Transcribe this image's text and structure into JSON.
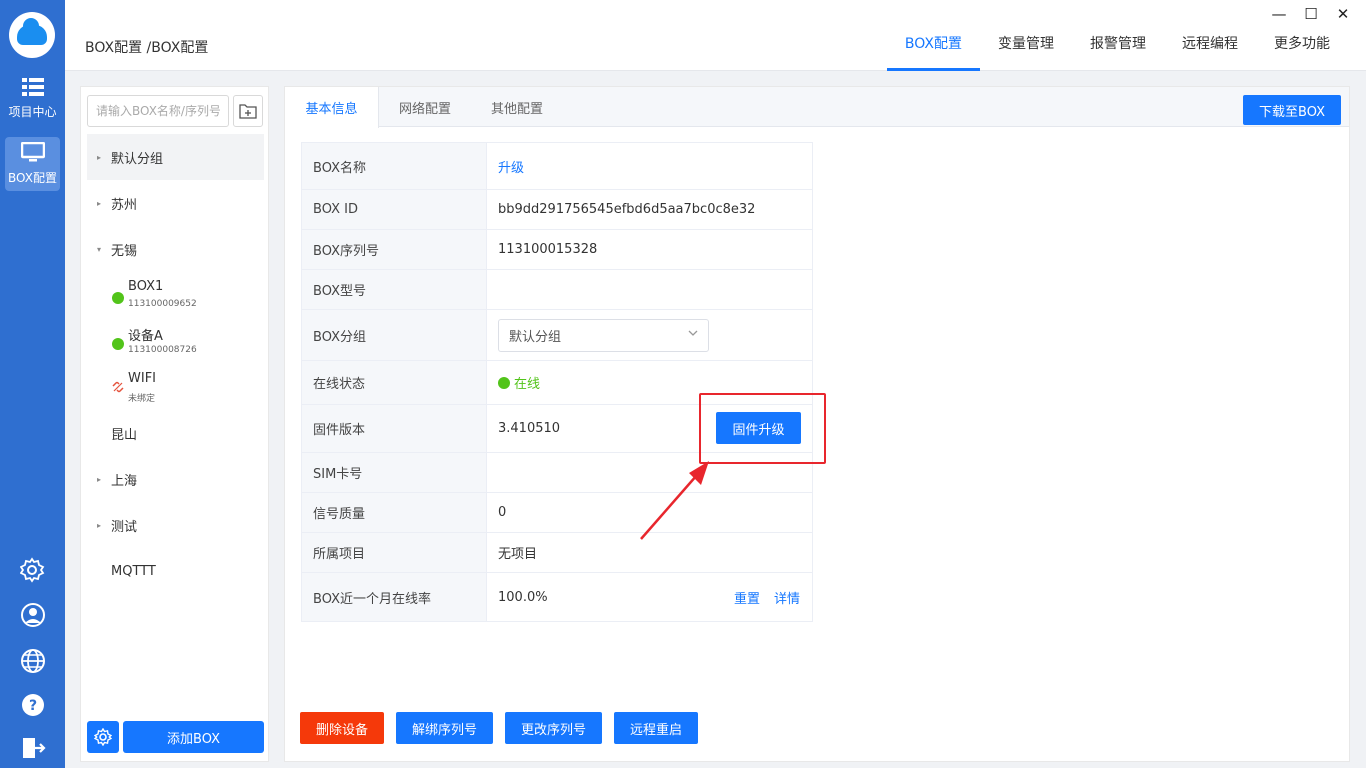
{
  "rail": {
    "items": [
      {
        "label": "项目中心",
        "icon": "grid-list-icon"
      },
      {
        "label": "BOX配置",
        "icon": "monitor-icon"
      }
    ],
    "bottom_icons": [
      "gear-wifi-icon",
      "user-icon",
      "globe-icon",
      "help-icon",
      "logout-icon"
    ]
  },
  "header": {
    "breadcrumb": "BOX配置 /BOX配置",
    "nav": [
      "BOX配置",
      "变量管理",
      "报警管理",
      "远程编程",
      "更多功能"
    ],
    "active_nav": "BOX配置"
  },
  "tree": {
    "search_placeholder": "请输入BOX名称/序列号",
    "groups": [
      {
        "label": "默认分组",
        "arrow": "▸"
      },
      {
        "label": "苏州",
        "arrow": "▸"
      },
      {
        "label": "无锡",
        "arrow": "▾"
      }
    ],
    "devices": [
      {
        "name": "BOX1",
        "sn": "113100009652",
        "status": "online"
      },
      {
        "name": "设备A",
        "sn": "113100008726",
        "status": "online"
      },
      {
        "name": "WIFI",
        "sn": "未绑定",
        "status": "unbound"
      }
    ],
    "groups_after": [
      {
        "label": "昆山",
        "arrow": ""
      },
      {
        "label": "上海",
        "arrow": "▸"
      },
      {
        "label": "测试",
        "arrow": "▸"
      },
      {
        "label": "MQTTT",
        "arrow": ""
      }
    ],
    "add_box": "添加BOX"
  },
  "tabs": [
    "基本信息",
    "网络配置",
    "其他配置"
  ],
  "download_button": "下载至BOX",
  "info": {
    "name_label": "BOX名称",
    "name_value": "升级",
    "id_label": "BOX ID",
    "id_value": "bb9dd291756545efbd6d5aa7bc0c8e32",
    "sn_label": "BOX序列号",
    "sn_value": "113100015328",
    "model_label": "BOX型号",
    "model_value": "",
    "group_label": "BOX分组",
    "group_value": "默认分组",
    "status_label": "在线状态",
    "status_value": "在线",
    "fw_label": "固件版本",
    "fw_value": "3.410510",
    "sim_label": "SIM卡号",
    "sim_value": "",
    "signal_label": "信号质量",
    "signal_value": "0",
    "project_label": "所属项目",
    "project_value": "无项目",
    "rate_label": "BOX近一个月在线率",
    "rate_value": "100.0%",
    "reset_link": "重置",
    "detail_link": "详情"
  },
  "firmware_button": "固件升级",
  "actions": [
    "删除设备",
    "解绑序列号",
    "更改序列号",
    "远程重启"
  ],
  "colors": {
    "primary": "#1677ff",
    "rail": "#2f6fd0",
    "online": "#52c41a",
    "danger": "#f5390a",
    "highlight": "#e8262d"
  }
}
